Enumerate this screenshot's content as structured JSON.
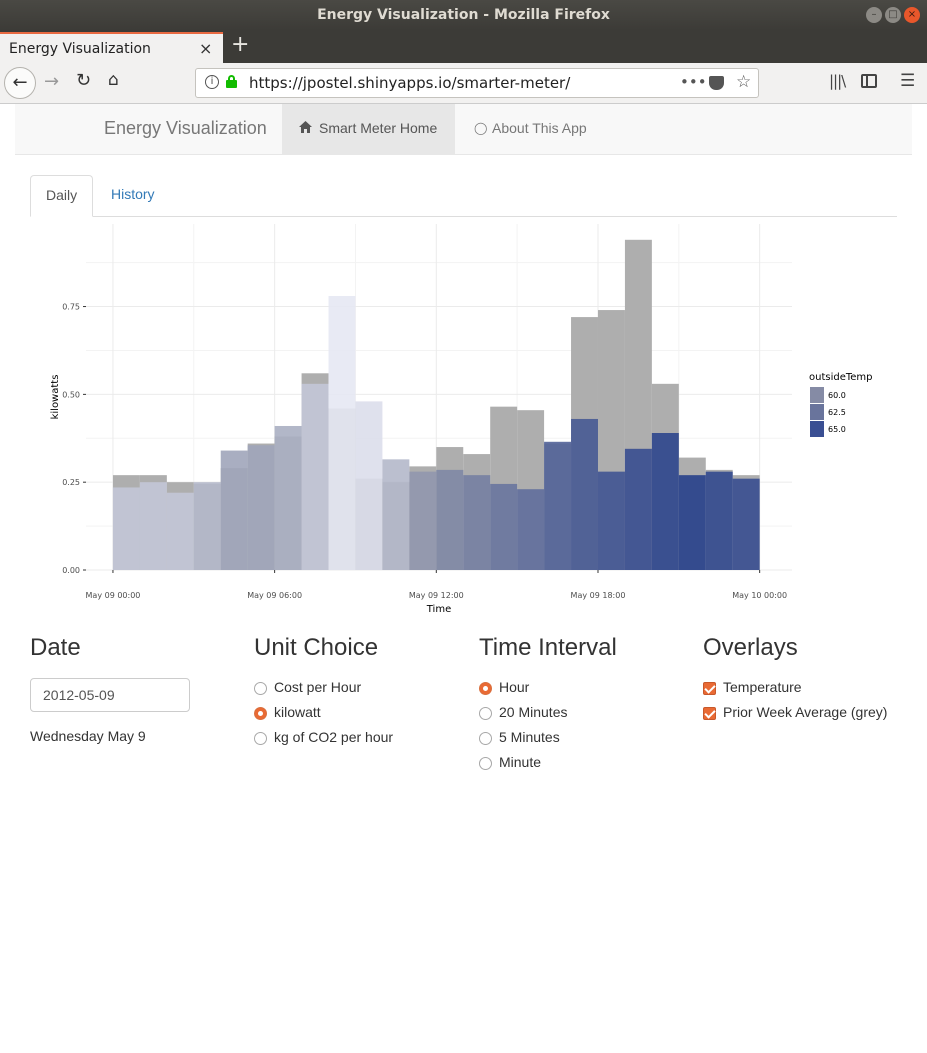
{
  "window": {
    "title": "Energy Visualization - Mozilla Firefox",
    "controls": {
      "minimize": "–",
      "maximize": "□",
      "close": "×"
    }
  },
  "browser": {
    "tab_title": "Energy Visualization",
    "tab_close": "×",
    "new_tab": "+",
    "url": "https://jpostel.shinyapps.io/smarter-meter/",
    "icons": {
      "back": "back-arrow-icon",
      "forward": "forward-arrow-icon",
      "reload": "reload-icon",
      "home": "home-icon",
      "info": "info-icon",
      "lock": "lock-icon",
      "page_actions": "more-icon",
      "pocket": "pocket-icon",
      "bookmark": "star-icon",
      "library": "library-icon",
      "sidebar": "sidebar-icon",
      "menu": "hamburger-menu-icon"
    },
    "glyphs": {
      "back": "←",
      "forward": "→",
      "reload": "↻",
      "home": "⌂",
      "info": "i",
      "dots": "•••",
      "star": "☆",
      "library": "|||\\",
      "menu": "☰"
    }
  },
  "app_nav": {
    "brand": "Energy Visualization",
    "items": [
      {
        "label": "Smart Meter Home",
        "icon": "home-icon",
        "active": true
      },
      {
        "label": "About This App",
        "icon": "lightbulb-icon",
        "active": false
      }
    ]
  },
  "tabs": [
    {
      "label": "Daily",
      "active": true
    },
    {
      "label": "History",
      "active": false
    }
  ],
  "chart_data": {
    "type": "bar",
    "xlabel": "Time",
    "ylabel": "kilowatts",
    "x_ticks": [
      "May 09 00:00",
      "May 09 06:00",
      "May 09 12:00",
      "May 09 18:00",
      "May 10 00:00"
    ],
    "x_tick_hours": [
      0,
      6,
      12,
      18,
      24
    ],
    "y_ticks": [
      0.0,
      0.25,
      0.5,
      0.75
    ],
    "y_tick_labels": [
      "0.00",
      "0.25",
      "0.50",
      "0.75"
    ],
    "xlim_hours": [
      -1,
      25.2
    ],
    "ylim": [
      0,
      0.985
    ],
    "grid": true,
    "legend": {
      "title": "outsideTemp",
      "placement": "right",
      "entries": [
        {
          "label": "60.0",
          "color": "#858ba5"
        },
        {
          "label": "62.5",
          "color": "#69749c"
        },
        {
          "label": "65.0",
          "color": "#3a4f93"
        }
      ]
    },
    "hours": [
      0,
      1,
      2,
      3,
      4,
      5,
      6,
      7,
      8,
      9,
      10,
      11,
      12,
      13,
      14,
      15,
      16,
      17,
      18,
      19,
      20,
      21,
      22,
      23
    ],
    "series": [
      {
        "name": "Prior Week Average (grey)",
        "colors": "#aeaeae",
        "values": [
          0.27,
          0.27,
          0.25,
          0.245,
          0.29,
          0.36,
          0.38,
          0.56,
          0.46,
          0.26,
          0.25,
          0.295,
          0.35,
          0.33,
          0.465,
          0.455,
          0.36,
          0.72,
          0.74,
          0.94,
          0.53,
          0.32,
          0.285,
          0.27
        ]
      },
      {
        "name": "kilowatt",
        "values": [
          0.235,
          0.25,
          0.22,
          0.25,
          0.34,
          0.355,
          0.41,
          0.53,
          0.78,
          0.48,
          0.315,
          0.28,
          0.285,
          0.27,
          0.245,
          0.23,
          0.365,
          0.43,
          0.28,
          0.345,
          0.39,
          0.27,
          0.28,
          0.26
        ],
        "temps": [
          59.5,
          59.5,
          59.5,
          59.8,
          60.2,
          60.2,
          60.0,
          59.5,
          58.8,
          59.0,
          59.8,
          60.5,
          61.2,
          61.8,
          62.5,
          63.0,
          63.8,
          64.4,
          64.8,
          65.2,
          65.8,
          66.2,
          65.6,
          65.2
        ]
      }
    ],
    "color_scale": {
      "low": 58.8,
      "high": 66.2,
      "low_color": "#e6e8f3",
      "mid_color": "#8a90a8",
      "high_color": "#27408b"
    }
  },
  "controls": {
    "date": {
      "heading": "Date",
      "value": "2012-05-09",
      "weekday": "Wednesday May 9"
    },
    "unit_choice": {
      "heading": "Unit Choice",
      "options": [
        {
          "label": "Cost per Hour",
          "selected": false
        },
        {
          "label": "kilowatt",
          "selected": true
        },
        {
          "label": "kg of CO2 per hour",
          "selected": false
        }
      ]
    },
    "time_interval": {
      "heading": "Time Interval",
      "options": [
        {
          "label": "Hour",
          "selected": true
        },
        {
          "label": "20 Minutes",
          "selected": false
        },
        {
          "label": "5 Minutes",
          "selected": false
        },
        {
          "label": "Minute",
          "selected": false
        }
      ]
    },
    "overlays": {
      "heading": "Overlays",
      "options": [
        {
          "label": "Temperature",
          "checked": true
        },
        {
          "label": "Prior Week Average (grey)",
          "checked": true
        }
      ]
    }
  },
  "colors": {
    "accent": "#e96a34",
    "link": "#337ab7",
    "tab_highlight": "#e96a42"
  }
}
